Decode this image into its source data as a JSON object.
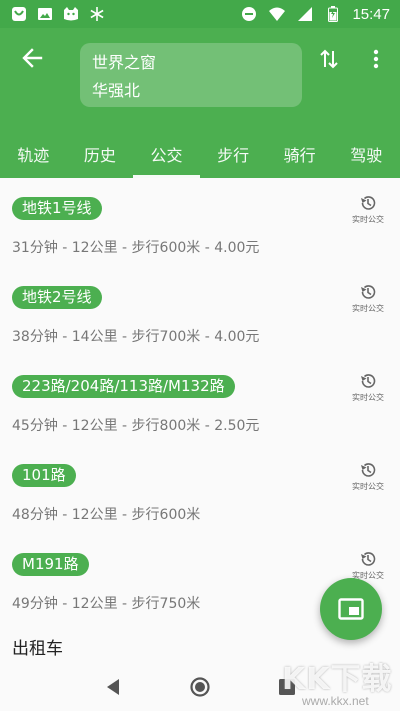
{
  "status_bar": {
    "time": "15:47",
    "left_icons": [
      "notification-app-icon",
      "image-icon",
      "cat-app-icon",
      "snowflake-icon"
    ],
    "right_icons": [
      "do-not-disturb-icon",
      "wifi-icon",
      "signal-icon",
      "battery-charging-icon"
    ]
  },
  "header": {
    "origin": "世界之窗",
    "destination": "华强北"
  },
  "tabs": [
    {
      "label": "轨迹"
    },
    {
      "label": "历史"
    },
    {
      "label": "公交"
    },
    {
      "label": "步行"
    },
    {
      "label": "骑行"
    },
    {
      "label": "驾驶"
    }
  ],
  "active_tab": "公交",
  "routes": [
    {
      "line": "地铁1号线",
      "detail": "31分钟 - 12公里 - 步行600米 - 4.00元",
      "realtime_label": "实时公交"
    },
    {
      "line": "地铁2号线",
      "detail": "38分钟 - 14公里 - 步行700米 - 4.00元",
      "realtime_label": "实时公交"
    },
    {
      "line": "223路/204路/113路/M132路",
      "detail": "45分钟 - 12公里 - 步行800米 - 2.50元",
      "realtime_label": "实时公交"
    },
    {
      "line": "101路",
      "detail": "48分钟 - 12公里 - 步行600米",
      "realtime_label": "实时公交"
    },
    {
      "line": "M191路",
      "detail": "49分钟 - 12公里 - 步行750米",
      "realtime_label": "实时公交"
    }
  ],
  "taxi_section_title": "出租车",
  "watermark": {
    "text": "KK下载",
    "url": "www.kkx.net"
  },
  "colors": {
    "primary": "#4caf50",
    "status_bar": "#43a94a",
    "detail_text": "#777777"
  }
}
